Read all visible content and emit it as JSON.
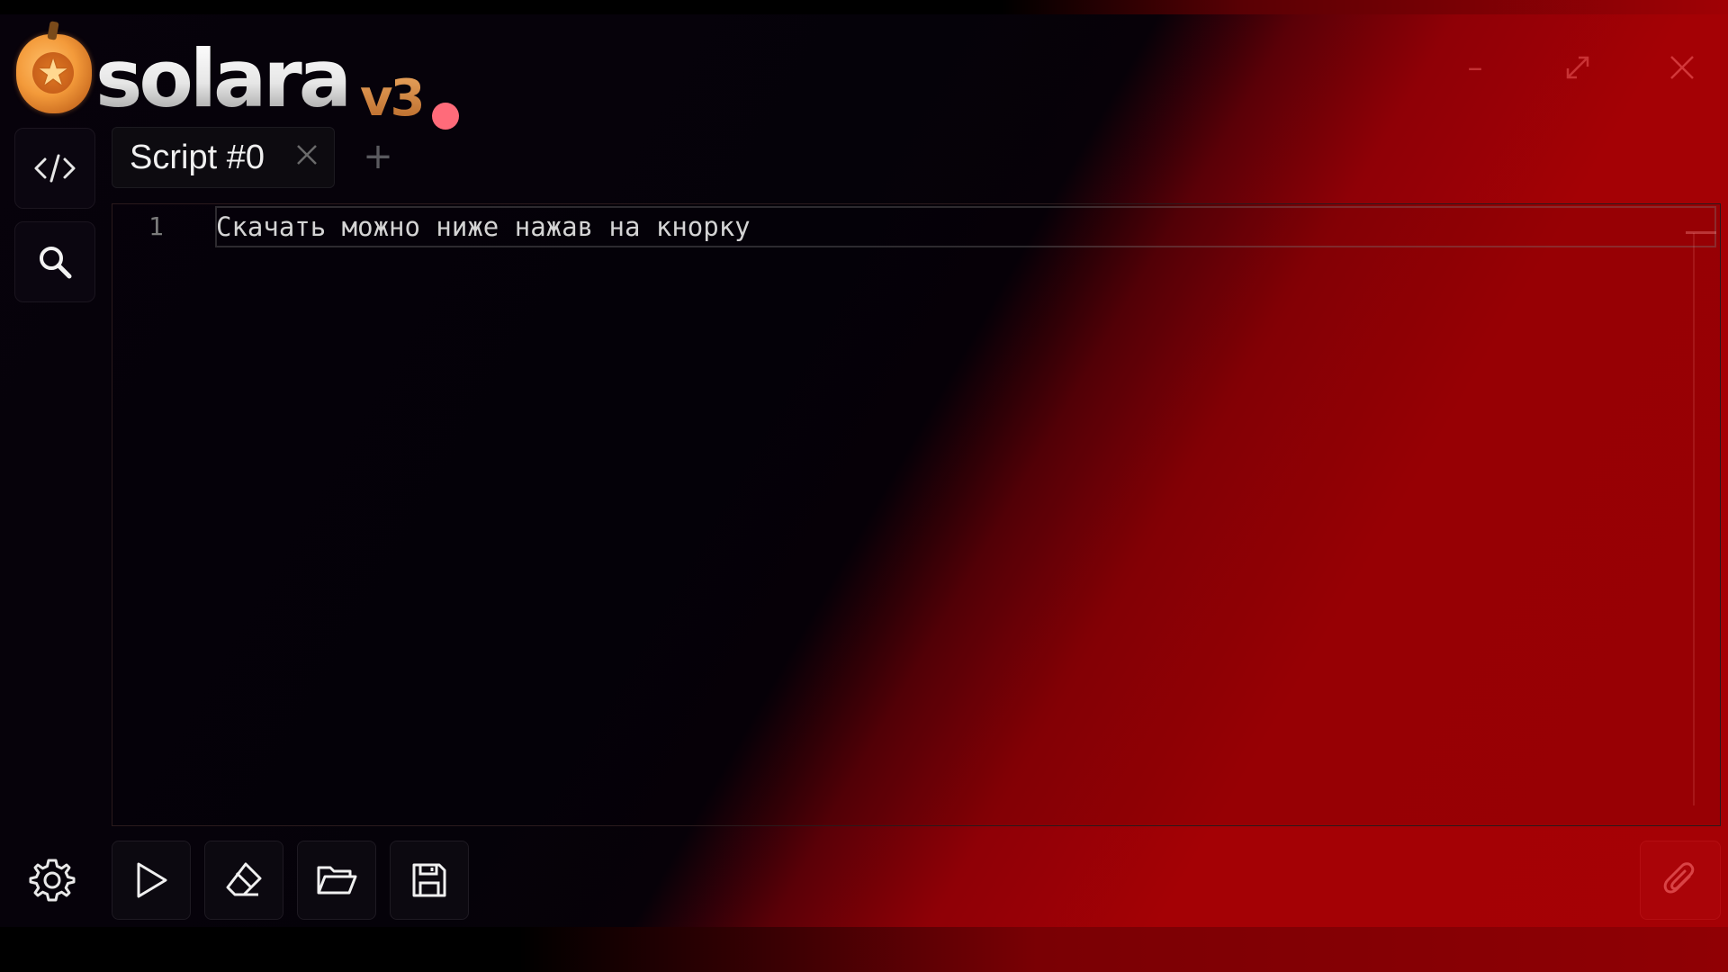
{
  "app": {
    "logo_text": "solara",
    "logo_version": "v3",
    "status_color": "#ff6b7a",
    "accent_color": "#a50105"
  },
  "window_controls": {
    "minimize_icon": "minimize-icon",
    "maximize_icon": "maximize-icon",
    "close_icon": "close-icon"
  },
  "sidebar": {
    "items": [
      {
        "icon": "code-icon"
      },
      {
        "icon": "search-icon"
      }
    ],
    "settings_icon": "gear-icon"
  },
  "tabs": [
    {
      "label": "Script #0",
      "close_icon": "close-icon"
    }
  ],
  "tab_add_label": "+",
  "editor": {
    "lines": [
      {
        "number": "1",
        "text": "Скачать можно ниже нажав на кнорку"
      }
    ]
  },
  "toolbar": {
    "buttons": [
      {
        "name": "execute",
        "icon": "play-icon"
      },
      {
        "name": "clear",
        "icon": "eraser-icon"
      },
      {
        "name": "open",
        "icon": "folder-open-icon"
      },
      {
        "name": "save",
        "icon": "save-icon"
      }
    ],
    "attach_icon": "paperclip-icon"
  }
}
